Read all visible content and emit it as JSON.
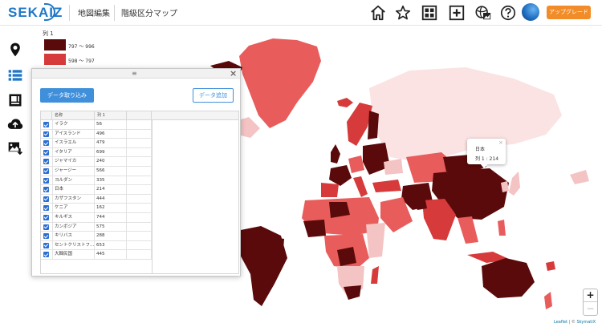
{
  "header": {
    "logo": "SEKAIZ",
    "nav": [
      "地図編集",
      "階級区分マップ"
    ],
    "upgrade": "アップグレード",
    "icons": [
      "home-icon",
      "star-icon",
      "grid-icon",
      "plus-square-icon",
      "globe-image-icon",
      "help-icon"
    ]
  },
  "sidebar": {
    "icons": [
      "map-pin-icon",
      "list-icon",
      "layers-icon",
      "cloud-upload-icon",
      "image-download-icon"
    ],
    "accent": "#1f77c9"
  },
  "legend": {
    "title": "列 1",
    "items": [
      {
        "label": "797 〜 996",
        "color": "#5a0a0a"
      },
      {
        "label": "598 〜 797",
        "color": "#d63a3a"
      }
    ]
  },
  "panel": {
    "import_label": "データ取り込み",
    "add_label": "データ追加",
    "columns": [
      "名称",
      "列 1"
    ],
    "rows": [
      {
        "name": "イラク",
        "value": "56"
      },
      {
        "name": "アイスランド",
        "value": "496"
      },
      {
        "name": "イスラエル",
        "value": "479"
      },
      {
        "name": "イタリア",
        "value": "699"
      },
      {
        "name": "ジャマイカ",
        "value": "240"
      },
      {
        "name": "ジャージー",
        "value": "566"
      },
      {
        "name": "ヨルダン",
        "value": "335"
      },
      {
        "name": "日本",
        "value": "214"
      },
      {
        "name": "カザフスタン",
        "value": "444"
      },
      {
        "name": "ケニア",
        "value": "162"
      },
      {
        "name": "キルギス",
        "value": "744"
      },
      {
        "name": "カンボジア",
        "value": "575"
      },
      {
        "name": "キリバス",
        "value": "288"
      },
      {
        "name": "セントクリストフ...",
        "value": "653"
      },
      {
        "name": "大韓民国",
        "value": "445"
      }
    ]
  },
  "tooltip": {
    "name": "日本",
    "value": "列 1 : 214"
  },
  "zoom": {
    "in": "+",
    "out": "−"
  },
  "attribution": {
    "leaflet": "Leaflet",
    "sep": " | © ",
    "provider": "SkymatiX"
  }
}
